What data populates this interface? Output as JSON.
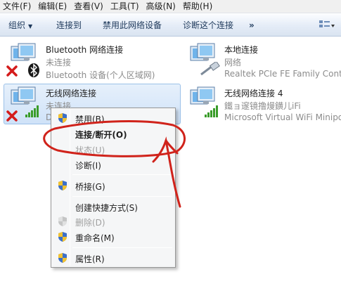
{
  "menubar": {
    "items": [
      "文件(F)",
      "编辑(E)",
      "查看(V)",
      "工具(T)",
      "高级(N)",
      "帮助(H)"
    ]
  },
  "toolbar": {
    "organize": "组织",
    "connect_to": "连接到",
    "disable_device": "禁用此网络设备",
    "diagnose": "诊断这个连接",
    "more": "»"
  },
  "connections": [
    {
      "name": "Bluetooth 网络连接",
      "status": "未连接",
      "device": "Bluetooth 设备(个人区域网)"
    },
    {
      "name": "本地连接",
      "status": "网络",
      "device": "Realtek PCIe FE Family Contr"
    },
    {
      "name": "无线网络连接",
      "status": "未连接",
      "device": "D"
    },
    {
      "name": "无线网络连接 4",
      "status": "鐵ョ邃镜撸熳鐄儿iFi",
      "device": "Microsoft Virtual WiFi Minipo"
    }
  ],
  "context_menu": {
    "items": [
      {
        "label": "禁用(B)",
        "shield": true,
        "disabled": false,
        "bold": false
      },
      {
        "label": "连接/断开(O)",
        "shield": false,
        "disabled": false,
        "bold": true
      },
      {
        "label": "状态(U)",
        "shield": false,
        "disabled": true,
        "bold": false
      },
      {
        "label": "诊断(I)",
        "shield": false,
        "disabled": false,
        "bold": false
      },
      {
        "label": "桥接(G)",
        "shield": true,
        "disabled": false,
        "bold": false
      },
      {
        "label": "创建快捷方式(S)",
        "shield": false,
        "disabled": false,
        "bold": false
      },
      {
        "label": "删除(D)",
        "shield": true,
        "disabled": true,
        "bold": false
      },
      {
        "label": "重命名(M)",
        "shield": true,
        "disabled": false,
        "bold": false
      },
      {
        "label": "属性(R)",
        "shield": true,
        "disabled": false,
        "bold": false
      }
    ]
  },
  "icons": {
    "monitor": "network-monitor-icon",
    "error": "red-x-icon",
    "bluetooth": "bluetooth-icon",
    "signal": "wifi-signal-icon",
    "cable": "network-cable-icon",
    "shield": "uac-shield-icon"
  },
  "colors": {
    "annotation": "#d0231b",
    "selection": "#cfe2f8",
    "toolbar_text": "#1e395b"
  }
}
